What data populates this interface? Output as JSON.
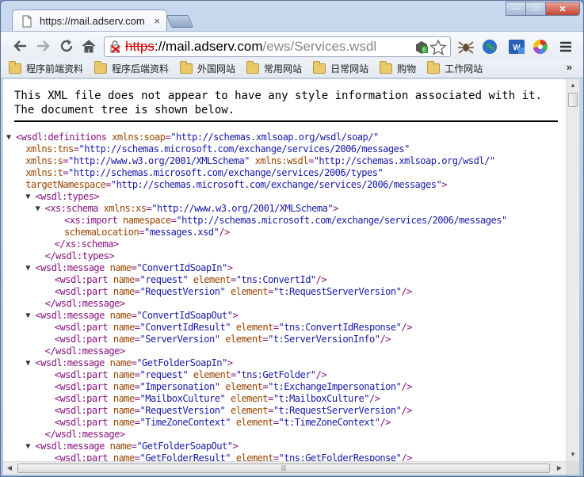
{
  "tab": {
    "title": "https://mail.adserv.com",
    "close": "×"
  },
  "window": {
    "minimize": "—",
    "maximize": "□",
    "close": "✕"
  },
  "omnibox": {
    "scheme": "https",
    "separator": "://",
    "host": "mail.adserv.com",
    "path": "/ews/Services.wsdl"
  },
  "bookmarks": {
    "items": [
      "程序前端资料",
      "程序后端资料",
      "外国网站",
      "常用网站",
      "日常网站",
      "购物",
      "工作网站"
    ],
    "more": "»"
  },
  "notice": "This XML file does not appear to have any style information associated with it. The document tree is shown below.",
  "xml_lines": [
    {
      "indent": 0,
      "tri": "▼",
      "parts": [
        [
          "t",
          "<wsdl:definitions "
        ],
        [
          "a",
          "xmlns:soap"
        ],
        [
          "t",
          "="
        ],
        [
          "v",
          "\"http://schemas.xmlsoap.org/wsdl/soap/\""
        ]
      ]
    },
    {
      "indent": 1,
      "tri": "",
      "parts": [
        [
          "a",
          "xmlns:tns"
        ],
        [
          "t",
          "="
        ],
        [
          "v",
          "\"http://schemas.microsoft.com/exchange/services/2006/messages\""
        ]
      ]
    },
    {
      "indent": 1,
      "tri": "",
      "parts": [
        [
          "a",
          "xmlns:s"
        ],
        [
          "t",
          "="
        ],
        [
          "v",
          "\"http://www.w3.org/2001/XMLSchema\" "
        ],
        [
          "a",
          "xmlns:wsdl"
        ],
        [
          "t",
          "="
        ],
        [
          "v",
          "\"http://schemas.xmlsoap.org/wsdl/\""
        ]
      ]
    },
    {
      "indent": 1,
      "tri": "",
      "parts": [
        [
          "a",
          "xmlns:t"
        ],
        [
          "t",
          "="
        ],
        [
          "v",
          "\"http://schemas.microsoft.com/exchange/services/2006/types\""
        ]
      ]
    },
    {
      "indent": 1,
      "tri": "",
      "parts": [
        [
          "a",
          "targetNamespace"
        ],
        [
          "t",
          "="
        ],
        [
          "v",
          "\"http://schemas.microsoft.com/exchange/services/2006/messages\""
        ],
        [
          "t",
          ">"
        ]
      ]
    },
    {
      "indent": 2,
      "tri": "▼",
      "parts": [
        [
          "t",
          "<wsdl:types>"
        ]
      ]
    },
    {
      "indent": 3,
      "tri": "▼",
      "parts": [
        [
          "t",
          "<xs:schema "
        ],
        [
          "a",
          "xmlns:xs"
        ],
        [
          "t",
          "="
        ],
        [
          "v",
          "\"http://www.w3.org/2001/XMLSchema\""
        ],
        [
          "t",
          ">"
        ]
      ]
    },
    {
      "indent": 5,
      "tri": "",
      "parts": [
        [
          "t",
          "<xs:import "
        ],
        [
          "a",
          "namespace"
        ],
        [
          "t",
          "="
        ],
        [
          "v",
          "\"http://schemas.microsoft.com/exchange/services/2006/messages\""
        ]
      ]
    },
    {
      "indent": 5,
      "tri": "",
      "parts": [
        [
          "a",
          "schemaLocation"
        ],
        [
          "t",
          "="
        ],
        [
          "v",
          "\"messages.xsd\""
        ],
        [
          "t",
          "/>"
        ]
      ]
    },
    {
      "indent": 4,
      "tri": "",
      "parts": [
        [
          "t",
          "</xs:schema>"
        ]
      ]
    },
    {
      "indent": 3,
      "tri": "",
      "parts": [
        [
          "t",
          "</wsdl:types>"
        ]
      ]
    },
    {
      "indent": 2,
      "tri": "▼",
      "parts": [
        [
          "t",
          "<wsdl:message "
        ],
        [
          "a",
          "name"
        ],
        [
          "t",
          "="
        ],
        [
          "v",
          "\"ConvertIdSoapIn\""
        ],
        [
          "t",
          ">"
        ]
      ]
    },
    {
      "indent": 4,
      "tri": "",
      "parts": [
        [
          "t",
          "<wsdl:part "
        ],
        [
          "a",
          "name"
        ],
        [
          "t",
          "="
        ],
        [
          "v",
          "\"request\" "
        ],
        [
          "a",
          "element"
        ],
        [
          "t",
          "="
        ],
        [
          "v",
          "\"tns:ConvertId\""
        ],
        [
          "t",
          "/>"
        ]
      ]
    },
    {
      "indent": 4,
      "tri": "",
      "parts": [
        [
          "t",
          "<wsdl:part "
        ],
        [
          "a",
          "name"
        ],
        [
          "t",
          "="
        ],
        [
          "v",
          "\"RequestVersion\" "
        ],
        [
          "a",
          "element"
        ],
        [
          "t",
          "="
        ],
        [
          "v",
          "\"t:RequestServerVersion\""
        ],
        [
          "t",
          "/>"
        ]
      ]
    },
    {
      "indent": 3,
      "tri": "",
      "parts": [
        [
          "t",
          "</wsdl:message>"
        ]
      ]
    },
    {
      "indent": 2,
      "tri": "▼",
      "parts": [
        [
          "t",
          "<wsdl:message "
        ],
        [
          "a",
          "name"
        ],
        [
          "t",
          "="
        ],
        [
          "v",
          "\"ConvertIdSoapOut\""
        ],
        [
          "t",
          ">"
        ]
      ]
    },
    {
      "indent": 4,
      "tri": "",
      "parts": [
        [
          "t",
          "<wsdl:part "
        ],
        [
          "a",
          "name"
        ],
        [
          "t",
          "="
        ],
        [
          "v",
          "\"ConvertIdResult\" "
        ],
        [
          "a",
          "element"
        ],
        [
          "t",
          "="
        ],
        [
          "v",
          "\"tns:ConvertIdResponse\""
        ],
        [
          "t",
          "/>"
        ]
      ]
    },
    {
      "indent": 4,
      "tri": "",
      "parts": [
        [
          "t",
          "<wsdl:part "
        ],
        [
          "a",
          "name"
        ],
        [
          "t",
          "="
        ],
        [
          "v",
          "\"ServerVersion\" "
        ],
        [
          "a",
          "element"
        ],
        [
          "t",
          "="
        ],
        [
          "v",
          "\"t:ServerVersionInfo\""
        ],
        [
          "t",
          "/>"
        ]
      ]
    },
    {
      "indent": 3,
      "tri": "",
      "parts": [
        [
          "t",
          "</wsdl:message>"
        ]
      ]
    },
    {
      "indent": 2,
      "tri": "▼",
      "parts": [
        [
          "t",
          "<wsdl:message "
        ],
        [
          "a",
          "name"
        ],
        [
          "t",
          "="
        ],
        [
          "v",
          "\"GetFolderSoapIn\""
        ],
        [
          "t",
          ">"
        ]
      ]
    },
    {
      "indent": 4,
      "tri": "",
      "parts": [
        [
          "t",
          "<wsdl:part "
        ],
        [
          "a",
          "name"
        ],
        [
          "t",
          "="
        ],
        [
          "v",
          "\"request\" "
        ],
        [
          "a",
          "element"
        ],
        [
          "t",
          "="
        ],
        [
          "v",
          "\"tns:GetFolder\""
        ],
        [
          "t",
          "/>"
        ]
      ]
    },
    {
      "indent": 4,
      "tri": "",
      "parts": [
        [
          "t",
          "<wsdl:part "
        ],
        [
          "a",
          "name"
        ],
        [
          "t",
          "="
        ],
        [
          "v",
          "\"Impersonation\" "
        ],
        [
          "a",
          "element"
        ],
        [
          "t",
          "="
        ],
        [
          "v",
          "\"t:ExchangeImpersonation\""
        ],
        [
          "t",
          "/>"
        ]
      ]
    },
    {
      "indent": 4,
      "tri": "",
      "parts": [
        [
          "t",
          "<wsdl:part "
        ],
        [
          "a",
          "name"
        ],
        [
          "t",
          "="
        ],
        [
          "v",
          "\"MailboxCulture\" "
        ],
        [
          "a",
          "element"
        ],
        [
          "t",
          "="
        ],
        [
          "v",
          "\"t:MailboxCulture\""
        ],
        [
          "t",
          "/>"
        ]
      ]
    },
    {
      "indent": 4,
      "tri": "",
      "parts": [
        [
          "t",
          "<wsdl:part "
        ],
        [
          "a",
          "name"
        ],
        [
          "t",
          "="
        ],
        [
          "v",
          "\"RequestVersion\" "
        ],
        [
          "a",
          "element"
        ],
        [
          "t",
          "="
        ],
        [
          "v",
          "\"t:RequestServerVersion\""
        ],
        [
          "t",
          "/>"
        ]
      ]
    },
    {
      "indent": 4,
      "tri": "",
      "parts": [
        [
          "t",
          "<wsdl:part "
        ],
        [
          "a",
          "name"
        ],
        [
          "t",
          "="
        ],
        [
          "v",
          "\"TimeZoneContext\" "
        ],
        [
          "a",
          "element"
        ],
        [
          "t",
          "="
        ],
        [
          "v",
          "\"t:TimeZoneContext\""
        ],
        [
          "t",
          "/>"
        ]
      ]
    },
    {
      "indent": 3,
      "tri": "",
      "parts": [
        [
          "t",
          "</wsdl:message>"
        ]
      ]
    },
    {
      "indent": 2,
      "tri": "▼",
      "parts": [
        [
          "t",
          "<wsdl:message "
        ],
        [
          "a",
          "name"
        ],
        [
          "t",
          "="
        ],
        [
          "v",
          "\"GetFolderSoapOut\""
        ],
        [
          "t",
          ">"
        ]
      ]
    },
    {
      "indent": 4,
      "tri": "",
      "parts": [
        [
          "t",
          "<wsdl:part "
        ],
        [
          "a",
          "name"
        ],
        [
          "t",
          "="
        ],
        [
          "v",
          "\"GetFolderResult\" "
        ],
        [
          "a",
          "element"
        ],
        [
          "t",
          "="
        ],
        [
          "v",
          "\"tns:GetFolderResponse\""
        ],
        [
          "t",
          "/>"
        ]
      ]
    }
  ],
  "icons": {
    "back": "back-arrow-icon",
    "forward": "forward-arrow-icon",
    "reload": "reload-icon",
    "home": "home-icon",
    "security": "broken-lock-icon",
    "extension": "extension-badge-icon",
    "bookmark": "star-icon",
    "spider": "spider-icon",
    "globe": "globe-icon",
    "ext2": "extension-tile-icon",
    "color": "color-wheel-icon",
    "menu": "menu-icon"
  },
  "colors": {
    "tag": "#881280",
    "attr": "#994500",
    "value": "#1a1aa6",
    "insecure": "#cc0000"
  }
}
